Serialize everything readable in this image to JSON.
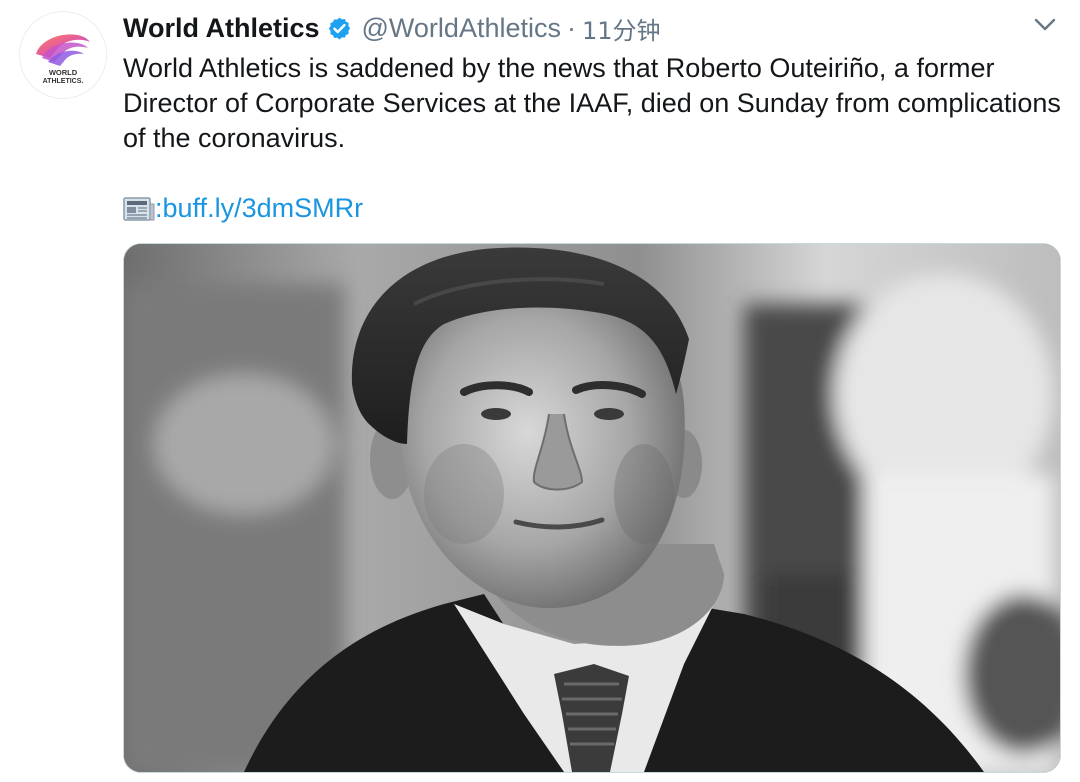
{
  "tweet": {
    "author": {
      "display_name": "World Athletics",
      "verified": true,
      "handle": "@WorldAthletics",
      "avatar_logo_text": [
        "WORLD",
        "ATHLETICS."
      ]
    },
    "separator": "·",
    "time": "11分钟",
    "text": "World Athletics is saddened by the news that Roberto Outeiriño, a former Director of Corporate Services at the IAAF, died on Sunday from complications of the coronavirus.",
    "link_prefix": ":",
    "link_text": "buff.ly/3dmSMRr",
    "media": {
      "type": "photo",
      "style": "black-and-white"
    },
    "icons": {
      "verified": "verified-badge-icon",
      "caret": "chevron-down-icon",
      "news": "newspaper-icon"
    },
    "colors": {
      "link": "#1b95e0",
      "verified": "#1da1f2",
      "muted": "#657786",
      "text": "#14171a"
    }
  }
}
